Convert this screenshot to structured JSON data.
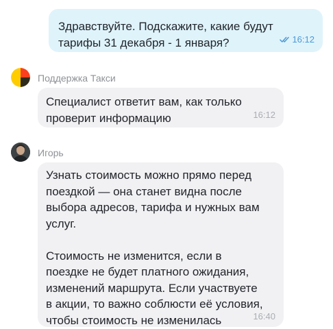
{
  "messages": {
    "outgoing": {
      "text": "Здравствуйте. Подскажите, какие будут\nтарифы 31 декабря - 1 января?",
      "time": "16:12",
      "status_icon": "double-check-icon"
    },
    "support": {
      "sender": "Поддержка Такси",
      "avatar_icon": "yandex-taxi-logo-icon",
      "text": "Специалист ответит вам, как только\nпроверит информацию",
      "time": "16:12"
    },
    "igor": {
      "sender": "Игорь",
      "avatar_icon": "user-photo-avatar",
      "text": "Узнать стоимость можно прямо перед\nпоездкой — она станет видна после\nвыбора адресов, тарифа и нужных вам\nуслуг.\n\nСтоимость не изменится, если в\nпоездке не будет платного ожидания,\nизменений маршрута. Если участвуете\nв акции, то важно соблюсти её условия,\nчтобы стоимость не изменилась",
      "time": "16:40"
    }
  },
  "colors": {
    "outgoing_bubble": "#dff3fb",
    "incoming_bubble": "#f1f1f3",
    "outgoing_time": "#4a9ad6",
    "incoming_time": "#a9adb3",
    "sender_name": "#8e9196",
    "text": "#22252b"
  }
}
